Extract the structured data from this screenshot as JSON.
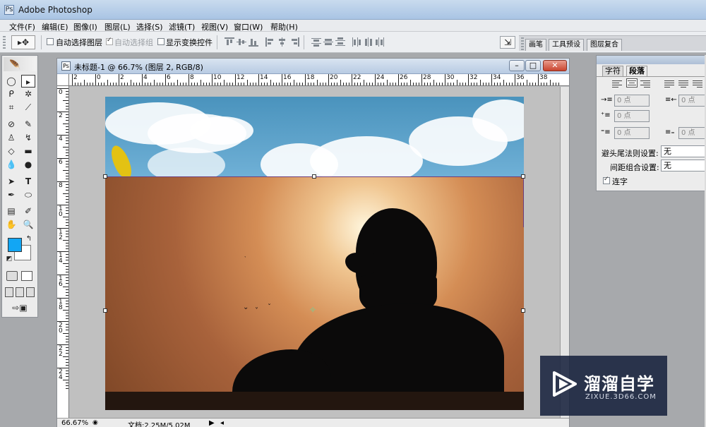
{
  "app": {
    "title": "Adobe Photoshop",
    "icon": "Ps"
  },
  "menu": [
    {
      "label": "文件(F)"
    },
    {
      "label": "编辑(E)"
    },
    {
      "label": "图像(I)"
    },
    {
      "label": "图层(L)"
    },
    {
      "label": "选择(S)"
    },
    {
      "label": "滤镜(T)"
    },
    {
      "label": "视图(V)"
    },
    {
      "label": "窗口(W)"
    },
    {
      "label": "帮助(H)"
    }
  ],
  "options": {
    "auto_select_layer": "自动选择图层",
    "auto_select_group": "自动选择组",
    "show_transform": "显示变换控件"
  },
  "palette_well": {
    "tabs": [
      "画笔",
      "工具预设",
      "图层复合"
    ]
  },
  "document": {
    "title": "未标题-1 @ 66.7% (图层 2, RGB/8)",
    "minimize": "–",
    "maximize": "□",
    "close": "✕",
    "ruler_h": [
      "2",
      "0",
      "2",
      "4",
      "6",
      "8",
      "10",
      "12",
      "14",
      "16",
      "18",
      "20",
      "22",
      "24",
      "26",
      "28",
      "30",
      "32",
      "34",
      "36",
      "38"
    ],
    "ruler_v": [
      "0",
      "2",
      "4",
      "6",
      "8",
      "1\n0",
      "1\n2",
      "1\n4",
      "1\n6",
      "1\n8",
      "2\n0",
      "2\n2",
      "2\n4"
    ],
    "zoom": "66.67%",
    "doc_info": "文档:2.25M/5.02M"
  },
  "paragraph_panel": {
    "tab_character": "字符",
    "tab_paragraph": "段落",
    "zero_pt": "0 点",
    "kinsoku_label": "避头尾法则设置:",
    "kinsoku_value": "无",
    "mojikumi_label": "间距组合设置:",
    "mojikumi_value": "无",
    "hyphenate_label": "连字",
    "hyphenate_checked": true
  },
  "tools": {
    "foreground_color": "#12a6f4",
    "background_color": "#ffffff"
  },
  "watermark": {
    "name": "溜溜自学",
    "url": "ZIXUE.3D66.COM"
  },
  "colors": {
    "accent": "#12a6f4",
    "titlebar": "#b8cbe3",
    "watermark_bg": "#18223e"
  }
}
